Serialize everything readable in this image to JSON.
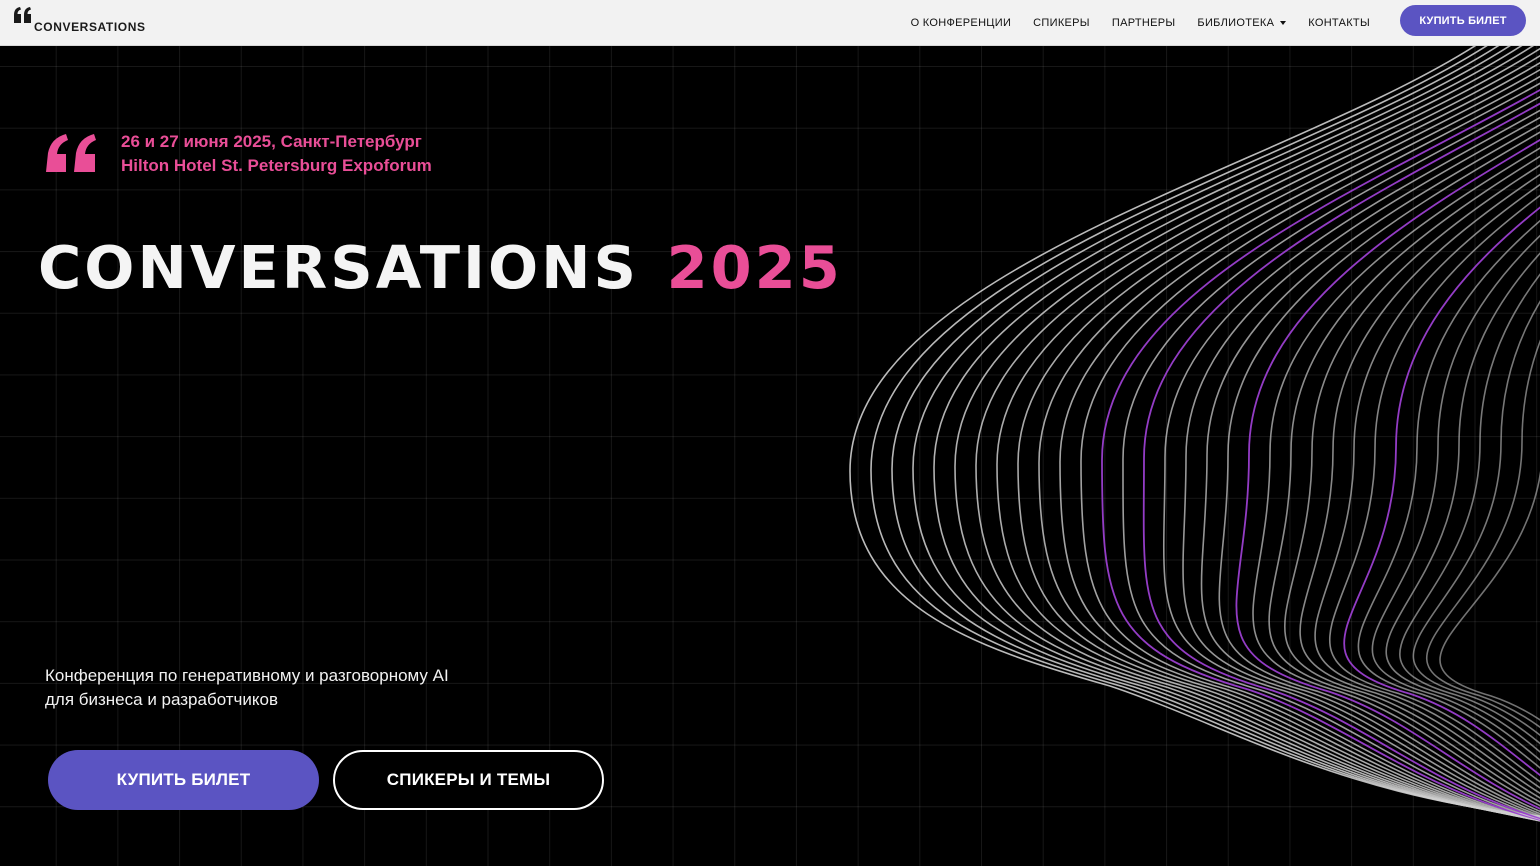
{
  "header": {
    "logo_text": "CONVERSATIONS",
    "nav": [
      {
        "label": "О КОНФЕРЕНЦИИ"
      },
      {
        "label": "СПИКЕРЫ"
      },
      {
        "label": "ПАРТНЕРЫ"
      },
      {
        "label": "БИБЛИОТЕКА"
      },
      {
        "label": "КОНТАКТЫ"
      }
    ],
    "cta_label": "КУПИТЬ БИЛЕТ"
  },
  "hero": {
    "date_line": "26 и 27 июня 2025, Санкт-Петербург",
    "venue_line": "Hilton Hotel St. Petersburg Expoforum",
    "title_main": "CONVERSATIONS",
    "title_year": "2025",
    "tagline_line1": "Конференция по генеративному и разговорному AI",
    "tagline_line2": "для бизнеса и разработчиков",
    "primary_button": "КУПИТЬ БИЛЕТ",
    "secondary_button": "СПИКЕРЫ И ТЕМЫ"
  },
  "colors": {
    "accent_pink": "#e94e97",
    "accent_purple": "#5b54c2",
    "wave_purple": "#9b3fd0",
    "header_bg": "#f2f2f2",
    "hero_bg": "#000000"
  },
  "icons": {
    "logo_icon": "double-quote-icon",
    "hero_icon": "double-quote-icon",
    "dropdown_icon": "caret-down-icon"
  }
}
